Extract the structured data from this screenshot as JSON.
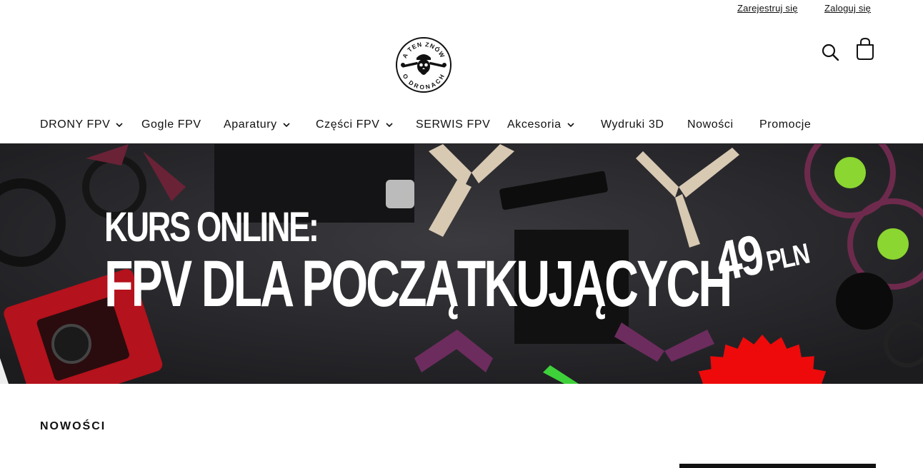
{
  "top_links": {
    "register": "Zarejestruj się",
    "login": "Zaloguj się"
  },
  "logo": {
    "top_text": "A TEN ZNÓW",
    "bottom_text": "O DRONACH",
    "icon": "skull-wrench-logo"
  },
  "header_icons": {
    "search": "search-icon",
    "cart": "shopping-bag-icon"
  },
  "nav": {
    "items": [
      {
        "label": "DRONY FPV",
        "dropdown": true
      },
      {
        "label": "Gogle FPV",
        "dropdown": false
      },
      {
        "label": "Aparatury",
        "dropdown": true
      },
      {
        "label": "Części FPV",
        "dropdown": true
      },
      {
        "label": "SERWIS FPV",
        "dropdown": false
      },
      {
        "label": "Akcesoria",
        "dropdown": true
      },
      {
        "label": "Wydruki 3D",
        "dropdown": false
      },
      {
        "label": "Nowości",
        "dropdown": false
      },
      {
        "label": "Promocje",
        "dropdown": false
      }
    ]
  },
  "hero": {
    "line1": "KURS ONLINE:",
    "line2": "FPV DLA POCZĄTKUJĄCYCH",
    "price_value": "49",
    "price_currency": "PLN",
    "badge_color": "#ee0a0a"
  },
  "sections": {
    "new_title": "NOWOŚCI"
  }
}
